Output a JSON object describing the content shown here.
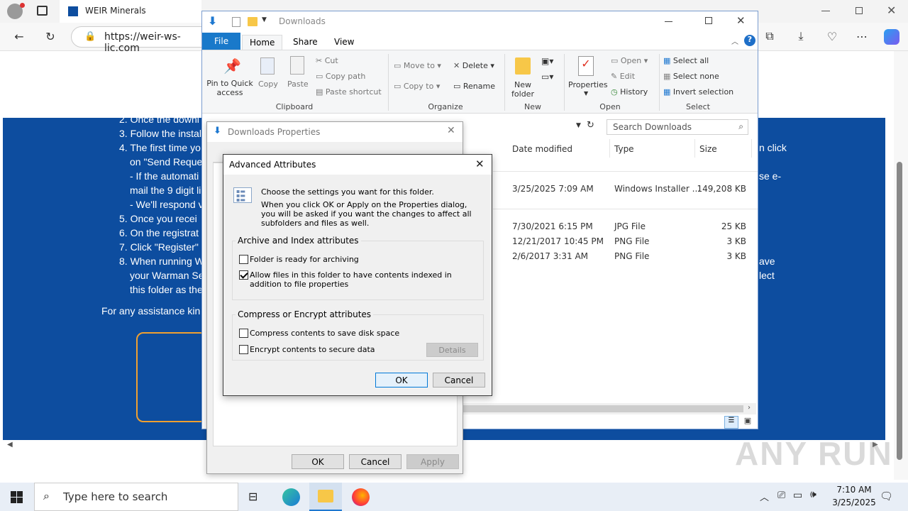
{
  "browser": {
    "tab_title": "WEIR Minerals",
    "address": "https://weir-ws-lic.com",
    "page": {
      "lines": [
        "2. Once the downl",
        "3. Follow the instal",
        "4. The first time yo",
        "on \"Send Reque",
        "- If the automati",
        "mail the 9 digit li",
        "- We'll respond v",
        "5. Once you recei",
        "6. On the registrat",
        "7. Click \"Register\"",
        "8. When running W",
        "your Warman Se",
        "this folder as the",
        "For any assistance kin"
      ],
      "right_fragments": [
        "n click",
        "se e-",
        "ave",
        "lect"
      ]
    },
    "watermark": "ANY RUN"
  },
  "explorer": {
    "title": "Downloads",
    "tabs": [
      "File",
      "Home",
      "Share",
      "View"
    ],
    "ribbon": {
      "clipboard": {
        "label": "Clipboard",
        "pin": "Pin to Quick access",
        "copy": "Copy",
        "paste": "Paste",
        "cut": "Cut",
        "copy_path": "Copy path",
        "paste_shortcut": "Paste shortcut"
      },
      "organize": {
        "label": "Organize",
        "move_to": "Move to",
        "copy_to": "Copy to",
        "delete": "Delete",
        "rename": "Rename"
      },
      "new": {
        "label": "New",
        "new_folder": "New folder"
      },
      "open": {
        "label": "Open",
        "properties": "Properties",
        "open": "Open",
        "edit": "Edit",
        "history": "History"
      },
      "select": {
        "label": "Select",
        "select_all": "Select all",
        "select_none": "Select none",
        "invert": "Invert selection"
      }
    },
    "search_placeholder": "Search Downloads",
    "columns": [
      "Date modified",
      "Type",
      "Size"
    ],
    "rows": [
      {
        "date": "3/25/2025 7:09 AM",
        "type": "Windows Installer ...",
        "size": "149,208 KB"
      },
      {
        "date": "7/30/2021 6:15 PM",
        "type": "JPG File",
        "size": "25 KB"
      },
      {
        "date": "12/21/2017 10:45 PM",
        "type": "PNG File",
        "size": "3 KB"
      },
      {
        "date": "2/6/2017 3:31 AM",
        "type": "PNG File",
        "size": "3 KB"
      }
    ]
  },
  "properties": {
    "title": "Downloads Properties",
    "ok": "OK",
    "cancel": "Cancel",
    "apply": "Apply"
  },
  "advanced": {
    "title": "Advanced Attributes",
    "intro": "Choose the settings you want for this folder.",
    "note": "When you click OK or Apply on the Properties dialog, you will be asked if you want the changes to affect all subfolders and files as well.",
    "archive_group": "Archive and Index attributes",
    "archive_label": "Folder is ready for archiving",
    "archive_checked": false,
    "index_label": "Allow files in this folder to have contents indexed in addition to file properties",
    "index_checked": true,
    "compress_group": "Compress or Encrypt attributes",
    "compress_label": "Compress contents to save disk space",
    "compress_checked": false,
    "encrypt_label": "Encrypt contents to secure data",
    "encrypt_checked": false,
    "details": "Details",
    "ok": "OK",
    "cancel": "Cancel"
  },
  "taskbar": {
    "search_placeholder": "Type here to search",
    "time": "7:10 AM",
    "date": "3/25/2025"
  }
}
